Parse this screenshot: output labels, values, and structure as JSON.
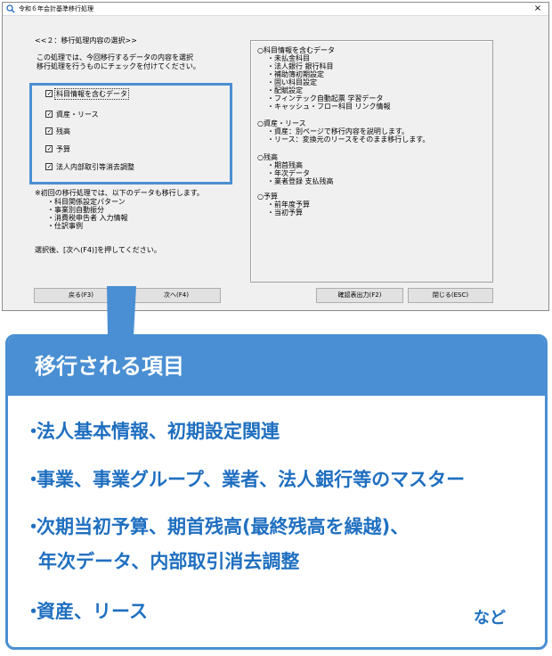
{
  "window": {
    "title": "令和６年会計基準移行処理",
    "close": "×"
  },
  "left": {
    "section_label": "<<２：移行処理内容の選択>>",
    "desc1": "この処理では、今回移行するデータの内容を選択",
    "desc2": "移行処理を行うものにチェックを付けてください。",
    "checkboxes": [
      "科目情報を含むデータ",
      "資産・リース",
      "残高",
      "予算",
      "法人内部取引等消去調整"
    ],
    "note_title": "※初回の移行処理では、以下のデータも移行します。",
    "note_items": [
      "・科目関係設定パターン",
      "・事業別自動振分",
      "・消費税申告者 入力情報",
      "・仕訳事例"
    ],
    "instruction": "選択後、[次へ(F4)]を押してください。"
  },
  "right": {
    "groups": [
      {
        "head": "○科目情報を含むデータ",
        "lines": [
          "・未払金科目",
          "・法人銀行 銀行科目",
          "・補助簿初期設定",
          "・固い科目設定",
          "・配賦設定",
          "・フィンテック自動起票 学習データ",
          "・キャッシュ・フロー科目 リンク情報"
        ]
      },
      {
        "head": "○資産・リース",
        "lines": [
          "・資産：別ページで移行内容を説明します。",
          "・リース：変換元のリースをそのまま移行します。"
        ]
      },
      {
        "head": "○残高",
        "lines": [
          "・期首残高",
          "・年次データ",
          "・業者登録 支払残高"
        ]
      },
      {
        "head": "○予算",
        "lines": [
          "・前年度予算",
          "・当初予算"
        ]
      }
    ]
  },
  "buttons": {
    "back": "戻る(F3)",
    "next": "次へ(F4)",
    "confirm_print": "確認表出力(F2)",
    "close": "閉じる(ESC)"
  },
  "panel": {
    "title": "移行される項目",
    "items": [
      "法人基本情報、初期設定関連",
      "事業、事業グループ、業者、法人銀行等のマスター",
      "次期当初予算、期首残高(最終残高を繰越)、",
      "年次データ、内部取引消去調整",
      "資産、リース"
    ],
    "bullet": "・",
    "footer": "など"
  },
  "colors": {
    "accent": "#4a8fd3",
    "text_blue": "#1f6fc0"
  }
}
